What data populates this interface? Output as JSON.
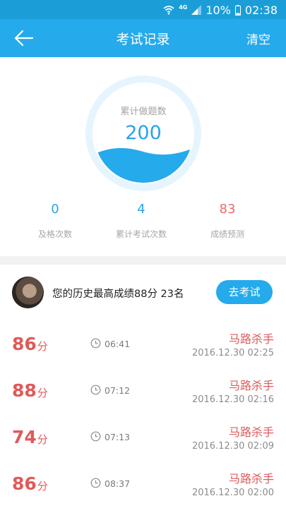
{
  "status_bar": {
    "network": "4G",
    "battery": "10%",
    "time": "02:38",
    "icons": [
      "wifi-icon",
      "signal-icon",
      "battery-icon"
    ]
  },
  "header": {
    "title": "考试记录",
    "clear_label": "清空",
    "back_icon": "back-arrow-icon"
  },
  "summary": {
    "gauge_label": "累计做题数",
    "gauge_value": "200",
    "stats": [
      {
        "value": "0",
        "label": "及格次数",
        "color": "#29a5e6"
      },
      {
        "value": "4",
        "label": "累计考试次数",
        "color": "#29a5e6"
      },
      {
        "value": "83",
        "label": "成绩预测",
        "color": "#ec6b6b"
      }
    ]
  },
  "best": {
    "text": "您的历史最高成绩88分  23名",
    "button_label": "去考试"
  },
  "records": [
    {
      "score": "86",
      "unit": "分",
      "duration": "06:41",
      "name": "马路杀手",
      "date": "2016.12.30  02:25"
    },
    {
      "score": "88",
      "unit": "分",
      "duration": "07:12",
      "name": "马路杀手",
      "date": "2016.12.30  02:16"
    },
    {
      "score": "74",
      "unit": "分",
      "duration": "07:13",
      "name": "马路杀手",
      "date": "2016.12.30  02:09"
    },
    {
      "score": "86",
      "unit": "分",
      "duration": "08:37",
      "name": "马路杀手",
      "date": "2016.12.30  02:00"
    }
  ],
  "colors": {
    "primary": "#25aaec",
    "status": "#1b9ed8",
    "score_red": "#e05a5a",
    "gauge_ring": "#e6f5fd"
  }
}
